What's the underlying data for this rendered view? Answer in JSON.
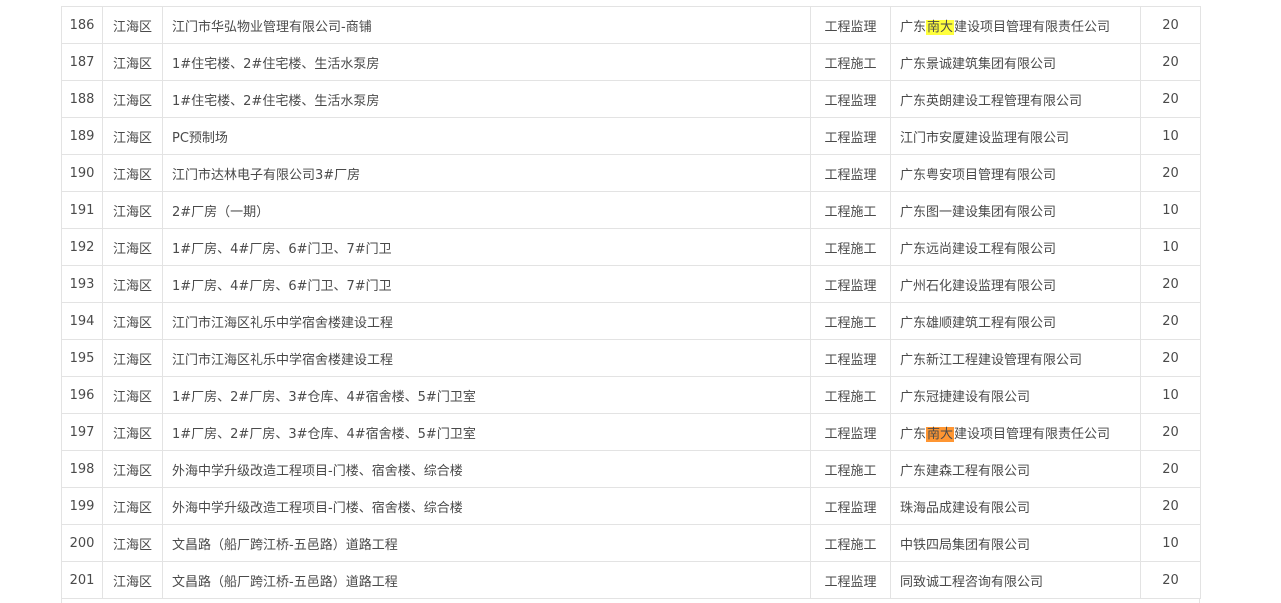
{
  "table": {
    "rows": [
      {
        "no": "186",
        "district": "江海区",
        "project": "江门市华弘物业管理有限公司-商铺",
        "type": "工程监理",
        "company_pre": "广东",
        "company_hl": "南大",
        "company_post": "建设项目管理有限责任公司",
        "score": "20"
      },
      {
        "no": "187",
        "district": "江海区",
        "project": "1#住宅楼、2#住宅楼、生活水泵房",
        "type": "工程施工",
        "company_pre": "广东景诚建筑集团有限公司",
        "company_hl": "",
        "company_post": "",
        "score": "20"
      },
      {
        "no": "188",
        "district": "江海区",
        "project": "1#住宅楼、2#住宅楼、生活水泵房",
        "type": "工程监理",
        "company_pre": "广东英朗建设工程管理有限公司",
        "company_hl": "",
        "company_post": "",
        "score": "20"
      },
      {
        "no": "189",
        "district": "江海区",
        "project": "PC预制场",
        "type": "工程监理",
        "company_pre": "江门市安厦建设监理有限公司",
        "company_hl": "",
        "company_post": "",
        "score": "10"
      },
      {
        "no": "190",
        "district": "江海区",
        "project": "江门市达林电子有限公司3#厂房",
        "type": "工程监理",
        "company_pre": "广东粤安项目管理有限公司",
        "company_hl": "",
        "company_post": "",
        "score": "20"
      },
      {
        "no": "191",
        "district": "江海区",
        "project": "2#厂房（一期）",
        "type": "工程施工",
        "company_pre": "广东图一建设集团有限公司",
        "company_hl": "",
        "company_post": "",
        "score": "10"
      },
      {
        "no": "192",
        "district": "江海区",
        "project": "1#厂房、4#厂房、6#门卫、7#门卫",
        "type": "工程施工",
        "company_pre": "广东远尚建设工程有限公司",
        "company_hl": "",
        "company_post": "",
        "score": "10"
      },
      {
        "no": "193",
        "district": "江海区",
        "project": "1#厂房、4#厂房、6#门卫、7#门卫",
        "type": "工程监理",
        "company_pre": "广州石化建设监理有限公司",
        "company_hl": "",
        "company_post": "",
        "score": "20"
      },
      {
        "no": "194",
        "district": "江海区",
        "project": "江门市江海区礼乐中学宿舍楼建设工程",
        "type": "工程施工",
        "company_pre": "广东雄顺建筑工程有限公司",
        "company_hl": "",
        "company_post": "",
        "score": "20"
      },
      {
        "no": "195",
        "district": "江海区",
        "project": "江门市江海区礼乐中学宿舍楼建设工程",
        "type": "工程监理",
        "company_pre": "广东新江工程建设管理有限公司",
        "company_hl": "",
        "company_post": "",
        "score": "20"
      },
      {
        "no": "196",
        "district": "江海区",
        "project": "1#厂房、2#厂房、3#仓库、4#宿舍楼、5#门卫室",
        "type": "工程施工",
        "company_pre": "广东冠捷建设有限公司",
        "company_hl": "",
        "company_post": "",
        "score": "10"
      },
      {
        "no": "197",
        "district": "江海区",
        "project": "1#厂房、2#厂房、3#仓库、4#宿舍楼、5#门卫室",
        "type": "工程监理",
        "company_pre": "广东",
        "company_hl": "南大",
        "company_post": "建设项目管理有限责任公司",
        "score": "20"
      },
      {
        "no": "198",
        "district": "江海区",
        "project": "外海中学升级改造工程项目-门楼、宿舍楼、综合楼",
        "type": "工程施工",
        "company_pre": "广东建森工程有限公司",
        "company_hl": "",
        "company_post": "",
        "score": "20"
      },
      {
        "no": "199",
        "district": "江海区",
        "project": "外海中学升级改造工程项目-门楼、宿舍楼、综合楼",
        "type": "工程监理",
        "company_pre": "珠海品成建设有限公司",
        "company_hl": "",
        "company_post": "",
        "score": "20"
      },
      {
        "no": "200",
        "district": "江海区",
        "project": "文昌路（船厂跨江桥-五邑路）道路工程",
        "type": "工程施工",
        "company_pre": "中铁四局集团有限公司",
        "company_hl": "",
        "company_post": "",
        "score": "10"
      },
      {
        "no": "201",
        "district": "江海区",
        "project": "文昌路（船厂跨江桥-五邑路）道路工程",
        "type": "工程监理",
        "company_pre": "同致诚工程咨询有限公司",
        "company_hl": "",
        "company_post": "",
        "score": "20"
      }
    ],
    "highlight_colors": {
      "search_match": "#ffff3c",
      "current_match": "#ff9632"
    },
    "current_match_row": 11,
    "border_color": "#e3e3e3",
    "text_color": "#4a4a4a"
  }
}
